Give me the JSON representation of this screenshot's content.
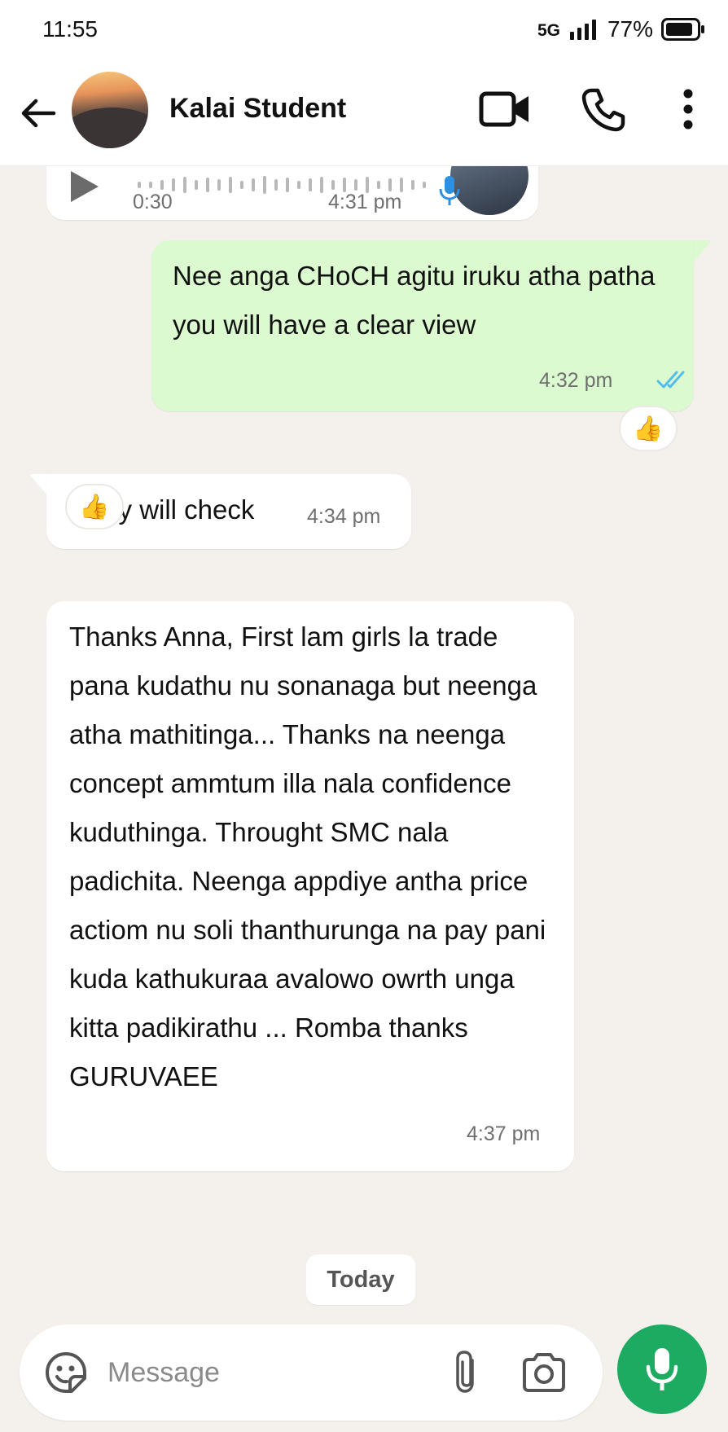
{
  "status_bar": {
    "time": "11:55",
    "network": "5G",
    "battery": "77%"
  },
  "header": {
    "contact_name": "Kalai Student"
  },
  "messages": {
    "voice": {
      "duration": "0:30",
      "time": "4:31 pm"
    },
    "out_1": {
      "text": "Nee anga CHoCH agitu iruku atha patha you will have a clear view",
      "time": "4:32 pm",
      "reaction": "👍"
    },
    "in_1": {
      "text": "Okay will check",
      "time": "4:34 pm",
      "reaction": "👍"
    },
    "in_2": {
      "text": "Thanks Anna, First lam girls la trade pana kudathu nu sonanaga but neenga atha mathitinga... Thanks na neenga concept ammtum illa nala confidence kuduthinga. Throught SMC nala padichita. Neenga appdiye antha price actiom nu soli thanthurunga na pay pani kuda kathukuraa avalowo owrth unga kitta padikirathu ... Romba thanks GURUVAEE",
      "time": "4:37 pm"
    }
  },
  "date_chip": "Today",
  "input": {
    "placeholder": "Message"
  },
  "colors": {
    "accent_green": "#1daa61",
    "outgoing_bubble": "#dcfad0",
    "read_ticks": "#53bdeb",
    "chat_background": "#f4f1ec"
  },
  "icons": [
    "back-arrow-icon",
    "video-call-icon",
    "phone-icon",
    "more-options-icon",
    "play-icon",
    "mic-icon",
    "double-check-icon",
    "sticker-icon",
    "attach-icon",
    "camera-icon"
  ]
}
